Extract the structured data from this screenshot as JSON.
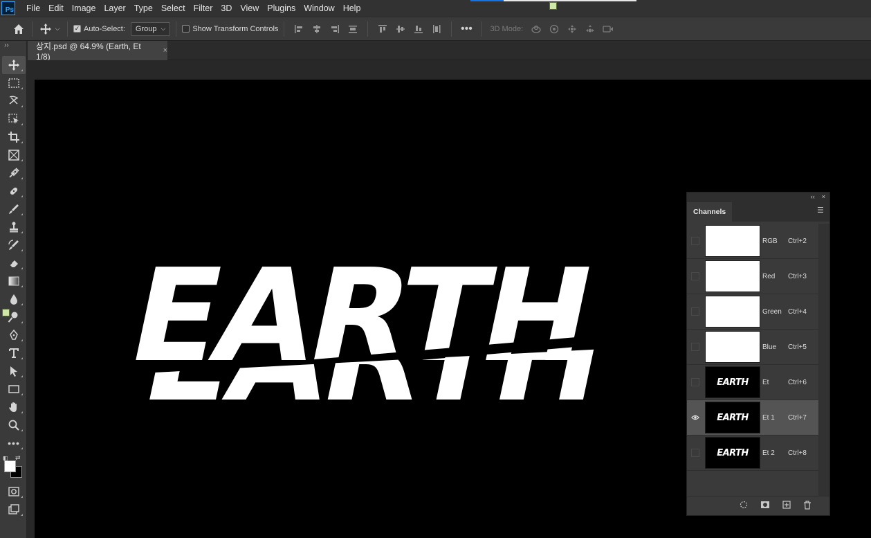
{
  "app": {
    "logo": "Ps"
  },
  "menu": [
    "File",
    "Edit",
    "Image",
    "Layer",
    "Type",
    "Select",
    "Filter",
    "3D",
    "View",
    "Plugins",
    "Window",
    "Help"
  ],
  "options_bar": {
    "auto_select_label": "Auto-Select:",
    "auto_select_checked": true,
    "group_value": "Group",
    "transform_label": "Show Transform Controls",
    "transform_checked": false,
    "mode_label": "3D Mode:"
  },
  "document_tab": {
    "title": "상지.psd @ 64.9% (Earth, Et 1/8)",
    "close": "×"
  },
  "canvas": {
    "artwork_text": "EARTH"
  },
  "channels_panel": {
    "title": "Channels",
    "topbar_collapse": "‹‹",
    "topbar_close": "×",
    "channels": [
      {
        "name": "RGB",
        "shortcut": "Ctrl+2",
        "thumb": "white",
        "thumb_text": "",
        "visible": false,
        "selected": false
      },
      {
        "name": "Red",
        "shortcut": "Ctrl+3",
        "thumb": "white",
        "thumb_text": "",
        "visible": false,
        "selected": false
      },
      {
        "name": "Green",
        "shortcut": "Ctrl+4",
        "thumb": "white",
        "thumb_text": "",
        "visible": false,
        "selected": false
      },
      {
        "name": "Blue",
        "shortcut": "Ctrl+5",
        "thumb": "white",
        "thumb_text": "",
        "visible": false,
        "selected": false
      },
      {
        "name": "Et",
        "shortcut": "Ctrl+6",
        "thumb": "black",
        "thumb_text": "EARTH",
        "visible": false,
        "selected": false
      },
      {
        "name": "Et 1",
        "shortcut": "Ctrl+7",
        "thumb": "black",
        "thumb_text": "EARTH",
        "visible": true,
        "selected": true
      },
      {
        "name": "Et 2",
        "shortcut": "Ctrl+8",
        "thumb": "black",
        "thumb_text": "EARTH",
        "visible": false,
        "selected": false
      }
    ]
  },
  "colors": {
    "foreground": "#ffffff",
    "background": "#000000"
  }
}
